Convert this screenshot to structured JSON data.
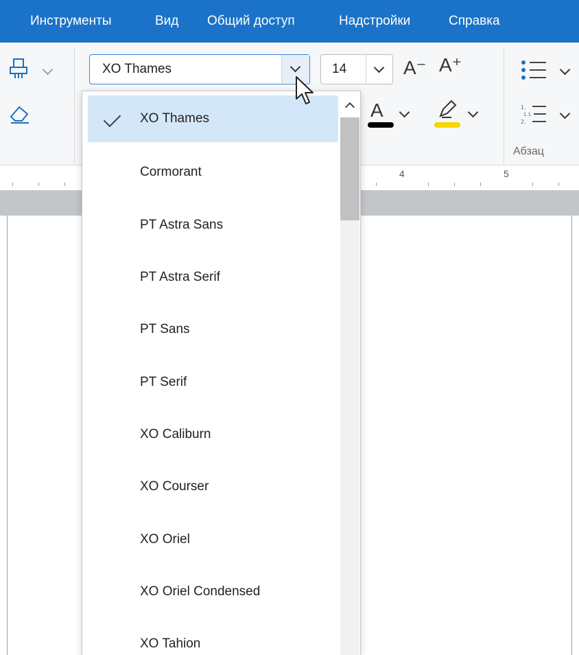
{
  "menu": {
    "items": [
      "Инструменты",
      "Вид",
      "Общий доступ",
      "Надстройки",
      "Справка"
    ]
  },
  "toolbar": {
    "font_name": "XO Thames",
    "font_size": "14",
    "decrease_font_label": "A⁻",
    "increase_font_label": "A⁺",
    "font_color_glyph": "A",
    "paragraph_group_label": "Абзац",
    "font_color": "#000000",
    "highlight_color": "#f5d800"
  },
  "ruler": {
    "numbers": [
      "4",
      "5"
    ]
  },
  "font_dropdown": {
    "selected": "XO Thames",
    "items": [
      "XO Thames",
      "Cormorant",
      "PT Astra Sans",
      "PT Astra Serif",
      "PT Sans",
      "PT Serif",
      "XO Caliburn",
      "XO Courser",
      "XO Oriel",
      "XO Oriel Condensed",
      "XO Tahion"
    ]
  },
  "colors": {
    "menubar": "#1a73c8",
    "accent": "#3b82d4",
    "selected_item": "#d4e7f8"
  }
}
